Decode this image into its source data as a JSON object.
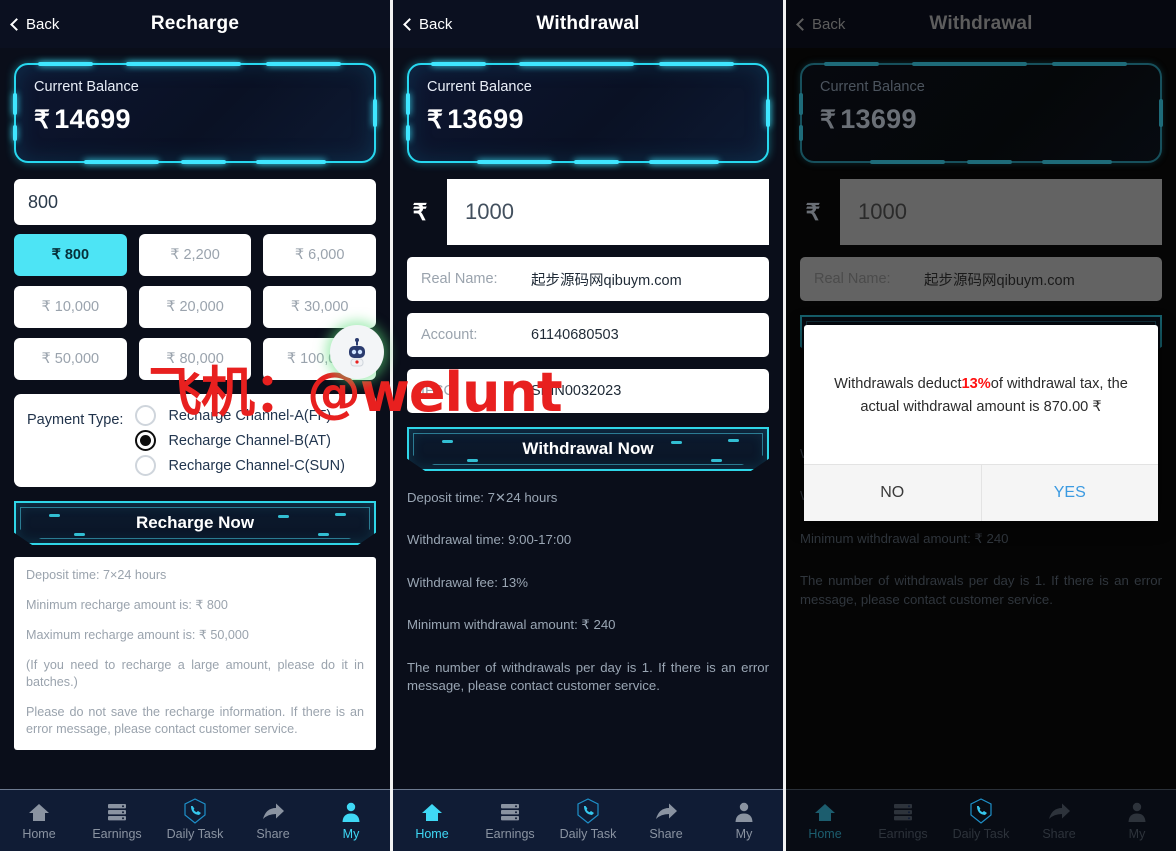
{
  "recharge": {
    "header": {
      "back": "Back",
      "title": "Recharge"
    },
    "balance": {
      "label": "Current Balance",
      "currency": "₹",
      "amount": "14699"
    },
    "amount_input": {
      "value": "800",
      "placeholder": "800"
    },
    "chips": [
      {
        "label": "₹ 800",
        "selected": true
      },
      {
        "label": "₹ 2,200",
        "selected": false
      },
      {
        "label": "₹ 6,000",
        "selected": false
      },
      {
        "label": "₹ 10,000",
        "selected": false
      },
      {
        "label": "₹ 20,000",
        "selected": false
      },
      {
        "label": "₹ 30,000",
        "selected": false
      },
      {
        "label": "₹ 50,000",
        "selected": false
      },
      {
        "label": "₹ 80,000",
        "selected": false
      },
      {
        "label": "₹ 100,000",
        "selected": false
      }
    ],
    "payment_type": {
      "label": "Payment Type:",
      "options": [
        {
          "label": "Recharge Channel-A(FF)",
          "selected": false
        },
        {
          "label": "Recharge Channel-B(AT)",
          "selected": true
        },
        {
          "label": "Recharge Channel-C(SUN)",
          "selected": false
        }
      ]
    },
    "submit_label": "Recharge Now",
    "notes": [
      "Deposit time: 7×24 hours",
      "Minimum recharge amount is: ₹ 800",
      "Maximum recharge amount is: ₹ 50,000",
      "(If you need to recharge a large amount, please do it in batches.)",
      "Please do not save the recharge information. If there is an error message, please contact customer service."
    ],
    "nav": [
      {
        "label": "Home",
        "icon": "home-icon",
        "active": false
      },
      {
        "label": "Earnings",
        "icon": "earnings-icon",
        "active": false
      },
      {
        "label": "Daily Task",
        "icon": "daily-task-icon",
        "active": false
      },
      {
        "label": "Share",
        "icon": "share-icon",
        "active": false
      },
      {
        "label": "My",
        "icon": "my-icon",
        "active": true
      }
    ]
  },
  "withdrawal": {
    "header": {
      "back": "Back",
      "title": "Withdrawal"
    },
    "balance": {
      "label": "Current Balance",
      "currency": "₹",
      "amount": "13699"
    },
    "amount": {
      "currency": "₹",
      "value": "1000"
    },
    "fields": [
      {
        "key": "Real Name:",
        "value": "起步源码网qibuym.com"
      },
      {
        "key": "Account:",
        "value": "61140680503"
      },
      {
        "key": "IFSC:",
        "value": "SBIN0032023"
      }
    ],
    "submit_label": "Withdrawal Now",
    "notes": [
      "Deposit time: 7✕24 hours",
      "Withdrawal time: 9:00-17:00",
      "Withdrawal fee: 13%",
      "Minimum withdrawal amount: ₹  240",
      "The number of withdrawals per day is 1. If there is an error message, please contact customer service."
    ],
    "nav": [
      {
        "label": "Home",
        "icon": "home-icon",
        "active": true
      },
      {
        "label": "Earnings",
        "icon": "earnings-icon",
        "active": false
      },
      {
        "label": "Daily Task",
        "icon": "daily-task-icon",
        "active": false
      },
      {
        "label": "Share",
        "icon": "share-icon",
        "active": false
      },
      {
        "label": "My",
        "icon": "my-icon",
        "active": false
      }
    ]
  },
  "withdrawal_dialog": {
    "header": {
      "back": "Back",
      "title": "Withdrawal"
    },
    "balance": {
      "label": "Current Balance",
      "currency": "₹",
      "amount": "13699"
    },
    "amount": {
      "currency": "₹",
      "value": "1000"
    },
    "fields": [
      {
        "key": "Real Name:",
        "value": "起步源码网qibuym.com"
      }
    ],
    "dialog": {
      "text_before": "Withdrawals deduct",
      "highlight": "13%",
      "text_after": "of withdrawal tax, the actual withdrawal amount is 870.00 ₹",
      "no_label": "NO",
      "yes_label": "YES",
      "highlight_color": "#ff1111",
      "yes_color": "#3b9ae1"
    },
    "notes": [
      "Withdrawal time: 9:00-17:00",
      "Withdrawal fee: 13%",
      "Minimum withdrawal amount: ₹  240",
      "The number of withdrawals per day is 1. If there is an error message, please contact customer service."
    ],
    "nav": [
      {
        "label": "Home",
        "icon": "home-icon",
        "active": true
      },
      {
        "label": "Earnings",
        "icon": "earnings-icon",
        "active": false
      },
      {
        "label": "Daily Task",
        "icon": "daily-task-icon",
        "active": false
      },
      {
        "label": "Share",
        "icon": "share-icon",
        "active": false
      },
      {
        "label": "My",
        "icon": "my-icon",
        "active": false
      }
    ]
  },
  "watermark": {
    "text": "飞机：@welunt",
    "color": "#e8201f"
  },
  "theme": {
    "accent": "#3fd8f5",
    "chip_selected": "#4de4f5",
    "panel_bg": "#0a0e1a"
  }
}
